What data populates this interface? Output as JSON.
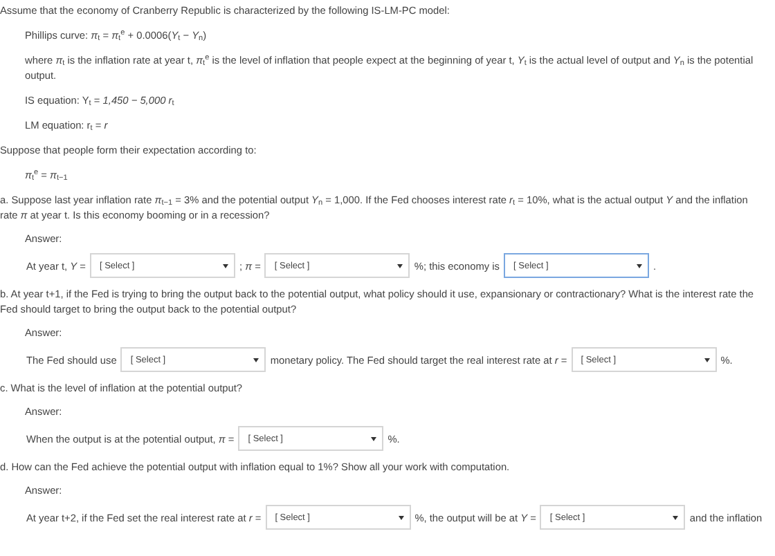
{
  "intro": "Assume that the economy of Cranberry Republic is characterized by the following IS-LM-PC model:",
  "model": [
    {
      "text": "Phillips curve: *π*$_{t}$ = *π*$_{t}$$^{e}$ + 0.0006(*Y*$_{t}$ − *Y*$_{n}$)"
    },
    {
      "text": "where *π*$_{t}$ is the inflation rate at year t, *π*$_{t}$$^{e}$ is the level of inflation that people expect at the beginning of year t, *Y*$_{t}$ is the actual level of output and *Y*$_{n}$ is the potential output."
    },
    {
      "text": "IS equation: Y$_{t}$ = *1,450 − 5,000 r*$_{t}$"
    },
    {
      "text": "LM equation: r$_{t}$ = *r*"
    }
  ],
  "expectation_intro": "Suppose that people form their expectation according to:",
  "expectation_formula": "*π*$_{t}$$^{e}$ = *π*$_{t−1}$",
  "questions": [
    {
      "text": "a. Suppose last year inflation rate *π*$_{t−1}$ = 3% and the potential output *Y*$_{n}$ = 1,000. If the Fed chooses interest rate *r*$_{t}$ = 10%, what is the actual output *Y* and the inflation rate *π* at year t. Is this economy booming or in a recession?",
      "answer_label": "Answer:",
      "answer": [
        {
          "kind": "text",
          "text": "At year t, *Y* ="
        },
        {
          "kind": "select",
          "placeholder": "[ Select ]",
          "focused": false
        },
        {
          "kind": "text",
          "text": "; *π* ="
        },
        {
          "kind": "select",
          "placeholder": "[ Select ]",
          "focused": false
        },
        {
          "kind": "text",
          "text": "%; this economy is"
        },
        {
          "kind": "select",
          "placeholder": "[ Select ]",
          "focused": true
        },
        {
          "kind": "text",
          "text": "."
        }
      ]
    },
    {
      "text": "b. At year t+1, if the Fed is trying to bring the output back to the potential output, what policy should it use, expansionary or contractionary? What is the interest rate the Fed should target to bring the output back to the potential output?",
      "answer_label": "Answer:",
      "answer": [
        {
          "kind": "text",
          "text": "The Fed should use"
        },
        {
          "kind": "select",
          "placeholder": "[ Select ]",
          "focused": false
        },
        {
          "kind": "text",
          "text": "monetary policy. The Fed should target the real interest rate at *r* ="
        },
        {
          "kind": "select",
          "placeholder": "[ Select ]",
          "focused": false
        },
        {
          "kind": "text",
          "text": "%."
        }
      ]
    },
    {
      "text": "c. What is the level of inflation at the potential output?",
      "answer_label": "Answer:",
      "answer": [
        {
          "kind": "text",
          "text": "When the output is at the potential output, *π* ="
        },
        {
          "kind": "select",
          "placeholder": "[ Select ]",
          "focused": false
        },
        {
          "kind": "text",
          "text": "%."
        }
      ]
    },
    {
      "text": "d. How can the Fed achieve the potential output with inflation equal to 1%? Show all your work with computation.",
      "answer_label": "Answer:",
      "answer": [
        {
          "kind": "text",
          "text": "At year t+2, if the Fed set the real interest rate at *r* ="
        },
        {
          "kind": "select",
          "placeholder": "[ Select ]",
          "focused": false
        },
        {
          "kind": "text",
          "text": "%, the output will be at *Y* ="
        },
        {
          "kind": "select",
          "placeholder": "[ Select ]",
          "focused": false
        },
        {
          "kind": "text",
          "text": "and the inflation"
        }
      ]
    }
  ]
}
